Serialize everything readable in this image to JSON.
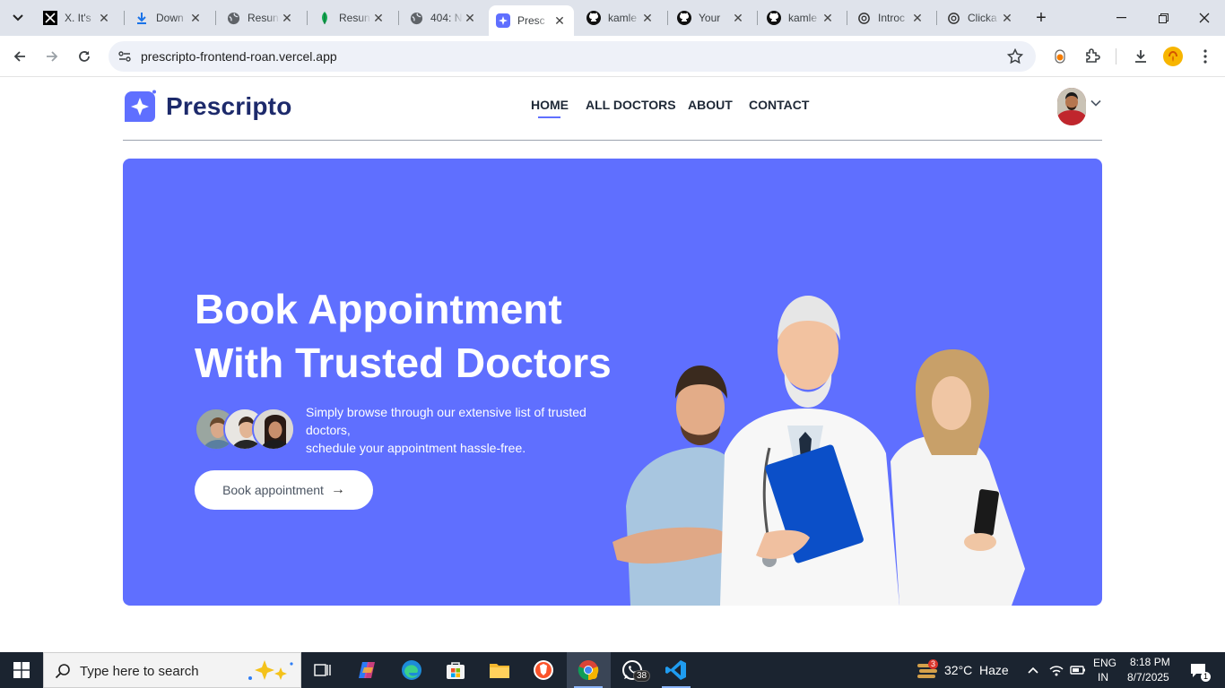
{
  "browser": {
    "tabs": [
      {
        "title": "X. It's",
        "icon": "x-logo-icon"
      },
      {
        "title": "Down",
        "icon": "download-icon"
      },
      {
        "title": "Resun",
        "icon": "globe-icon"
      },
      {
        "title": "Resun",
        "icon": "leaf-icon"
      },
      {
        "title": "404: N",
        "icon": "globe-icon"
      },
      {
        "title": "Presc",
        "icon": "prescripto-icon",
        "active": true
      },
      {
        "title": "kamle",
        "icon": "github-icon"
      },
      {
        "title": "Your",
        "icon": "github-icon"
      },
      {
        "title": "kamle",
        "icon": "github-icon"
      },
      {
        "title": "Introc",
        "icon": "openai-icon"
      },
      {
        "title": "Clicka",
        "icon": "openai-icon"
      }
    ],
    "url": "prescripto-frontend-roan.vercel.app"
  },
  "site": {
    "brand": "Prescripto",
    "nav": {
      "home": "HOME",
      "all_doctors": "ALL DOCTORS",
      "about": "ABOUT",
      "contact": "CONTACT"
    }
  },
  "hero": {
    "title_line1": "Book Appointment",
    "title_line2": "With Trusted Doctors",
    "desc_line1": "Simply browse through our extensive list of trusted",
    "desc_line2": "doctors,",
    "desc_line3": "schedule your appointment hassle-free.",
    "button_label": "Book appointment",
    "button_arrow": "→"
  },
  "taskbar": {
    "search_placeholder": "Type here to search",
    "whatsapp_badge": "38",
    "weather_badge": "3",
    "temperature": "32°C",
    "weather": "Haze",
    "lang1": "ENG",
    "lang2": "IN",
    "time": "8:18 PM",
    "date": "8/7/2025",
    "notification_count": "1"
  },
  "colors": {
    "accent": "#5f6fff",
    "brand_text": "#1d2a6b"
  }
}
